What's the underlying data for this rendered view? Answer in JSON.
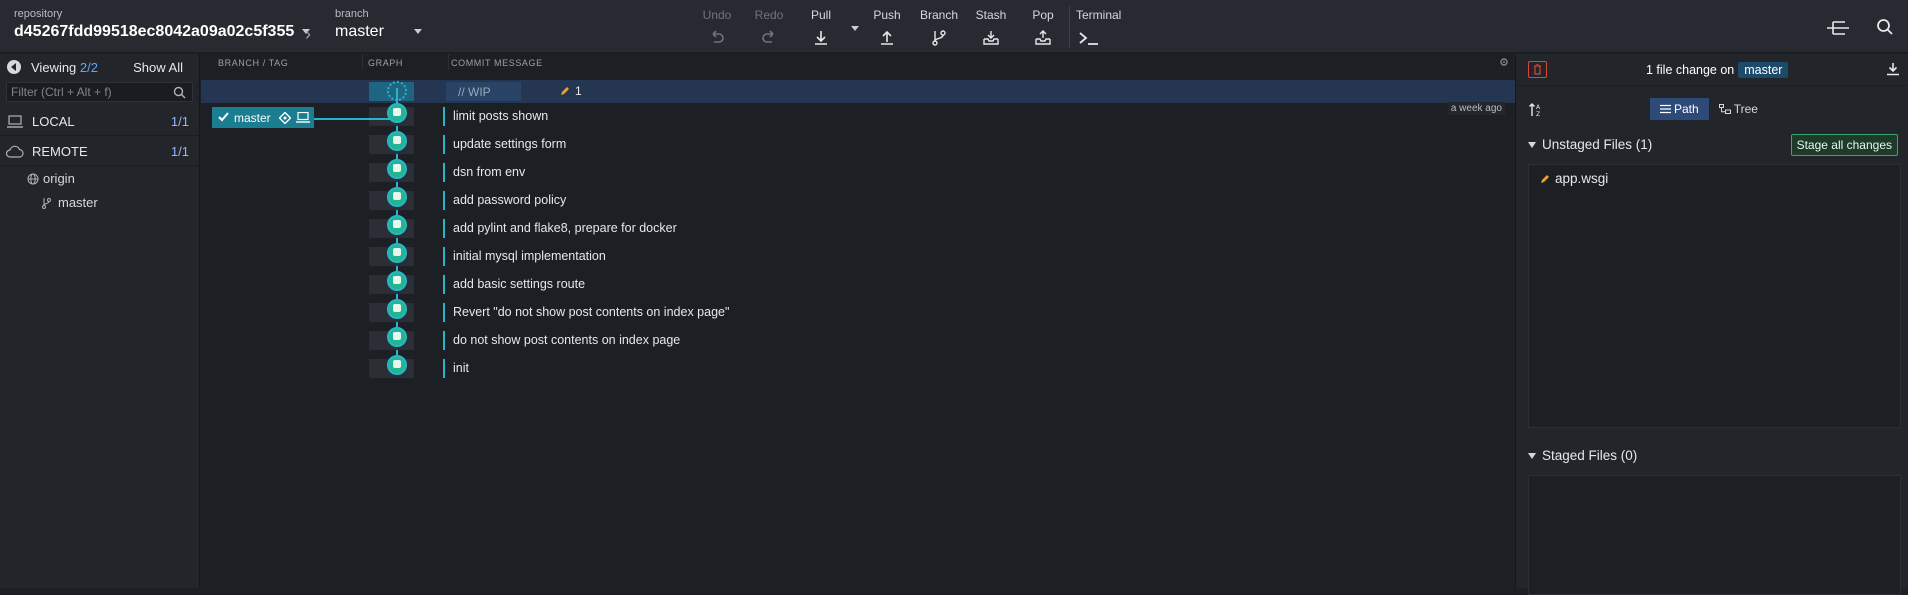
{
  "toolbar": {
    "repo_label": "repository",
    "repo_name": "d45267fdd99518ec8042a09a02c5f355",
    "branch_label": "branch",
    "branch_name": "master",
    "actions": [
      {
        "label": "Undo",
        "icon": "undo-icon",
        "enabled": false
      },
      {
        "label": "Redo",
        "icon": "redo-icon",
        "enabled": false
      },
      {
        "label": "Pull",
        "icon": "pull-icon",
        "enabled": true
      },
      {
        "label": "Push",
        "icon": "push-icon",
        "enabled": true
      },
      {
        "label": "Branch",
        "icon": "branch-icon",
        "enabled": true
      },
      {
        "label": "Stash",
        "icon": "stash-icon",
        "enabled": true
      },
      {
        "label": "Pop",
        "icon": "pop-icon",
        "enabled": true
      },
      {
        "label": "Terminal",
        "icon": "terminal-icon",
        "enabled": true
      }
    ]
  },
  "sidebar": {
    "viewing_label": "Viewing",
    "viewing_count": "2/2",
    "show_all": "Show All",
    "filter_placeholder": "Filter (Ctrl + Alt + f)",
    "local": {
      "label": "LOCAL",
      "count": "1/1"
    },
    "remote": {
      "label": "REMOTE",
      "count": "1/1"
    },
    "remote_items": [
      {
        "label": "origin",
        "icon": "globe-icon"
      },
      {
        "label": "master",
        "icon": "branch-icon"
      }
    ]
  },
  "graph": {
    "headers": [
      "BRANCH / TAG",
      "GRAPH",
      "COMMIT MESSAGE"
    ],
    "wip_text": "// WIP",
    "wip_changes": "1",
    "branch_pill": "master",
    "time_ago": "a week ago",
    "commits": [
      "limit posts shown",
      "update settings form",
      "dsn from env",
      "add password policy",
      "add pylint and flake8, prepare for docker",
      "initial mysql implementation",
      "add basic settings route",
      "Revert \"do not show post contents on index page\"",
      "do not show post contents on index page",
      "init"
    ]
  },
  "right_panel": {
    "title_prefix": "1 file change on",
    "title_branch": "master",
    "view_path": "Path",
    "view_tree": "Tree",
    "unstaged_title": "Unstaged Files (1)",
    "stage_all": "Stage all changes",
    "unstaged_files": [
      "app.wsgi"
    ],
    "staged_title": "Staged Files (0)"
  },
  "colors": {
    "accent": "#27b6c9",
    "node": "#22b58f",
    "wip_row": "#253653",
    "stage_button": "#3aa56a",
    "discard": "#d9443c"
  }
}
